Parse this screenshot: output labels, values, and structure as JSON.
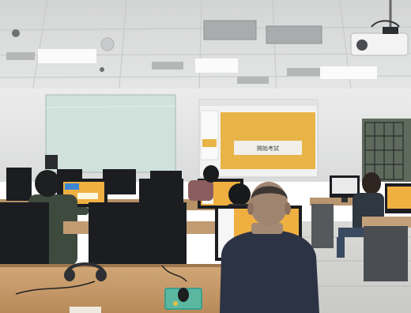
{
  "scene": {
    "projected_slide": {
      "button_text": "開始考試"
    },
    "colors": {
      "ceiling": "#dedfdf",
      "wall": "#e9eaea",
      "glass_board": "#cfe1da",
      "slide_orange": "#e9b447",
      "desk": "#c79a6b",
      "monitor": "#1b1d21",
      "screen_orange": "#f0b041"
    }
  }
}
